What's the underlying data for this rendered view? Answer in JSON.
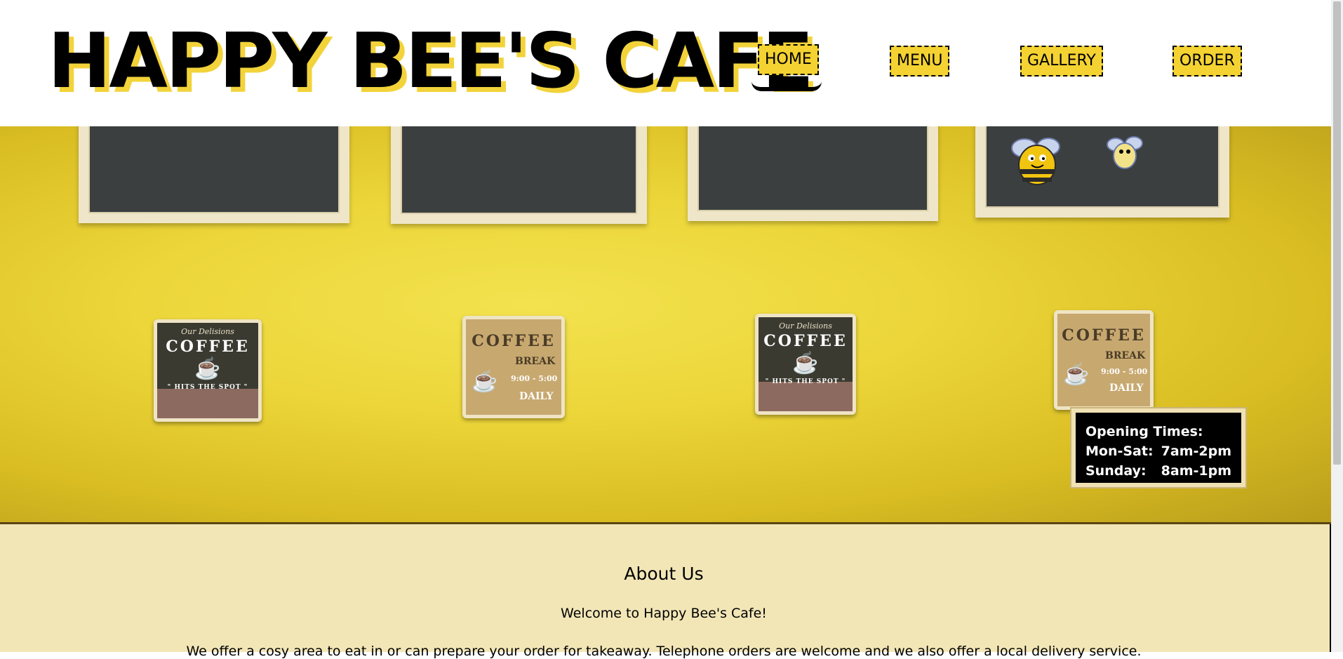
{
  "header": {
    "logo_text": "HAPPY BEE'S CAFE",
    "nav": [
      {
        "label": "HOME",
        "active": true
      },
      {
        "label": "MENU",
        "active": false
      },
      {
        "label": "GALLERY",
        "active": false
      },
      {
        "label": "ORDER",
        "active": false
      }
    ]
  },
  "hero": {
    "signs": [
      {
        "top_text": "Our Delisions",
        "title": "COFFEE",
        "footer": "\" HITS THE SPOT \""
      },
      {
        "title": "COFFEE",
        "line1": "BREAK",
        "line2": "9:00 - 5:00",
        "line3": "DAILY"
      },
      {
        "top_text": "Our Delisions",
        "title": "COFFEE",
        "footer": "\" HITS THE SPOT \""
      },
      {
        "title": "COFFEE",
        "line1": "BREAK",
        "line2": "9:00 - 5:00",
        "line3": "DAILY"
      }
    ],
    "opening_times": {
      "heading": "Opening Times:",
      "rows": [
        {
          "days": "Mon-Sat:",
          "hours": "7am-2pm"
        },
        {
          "days": "Sunday:",
          "hours": "8am-1pm"
        }
      ]
    }
  },
  "about": {
    "heading": "About Us",
    "welcome": "Welcome to Happy Bee's Cafe!",
    "description": "We offer a cosy area to eat in or can prepare your order for takeaway. Telephone orders are welcome and we also offer a local delivery service."
  },
  "colors": {
    "accent_yellow": "#f4d231",
    "logo_shadow": "#f2d33a",
    "about_bg": "#f2e6b7",
    "hours_bg": "#000000"
  }
}
